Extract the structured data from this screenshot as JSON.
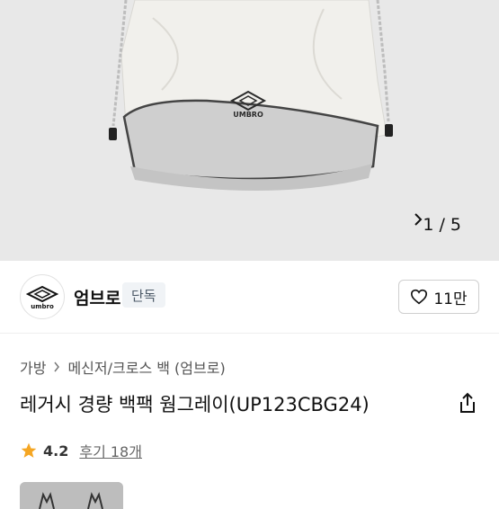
{
  "gallery": {
    "current": "1",
    "separator": "/",
    "total": "5",
    "next_icon": "chevron-right-icon",
    "background": "#e9e9e9"
  },
  "brand": {
    "logo_text": "umbro",
    "name": "엄브로",
    "badge": "단독",
    "like_count": "11만",
    "like_icon": "heart-outline-icon"
  },
  "breadcrumb": {
    "items": [
      "가방",
      "메신저/크로스 백 (엄브로)"
    ],
    "separator_icon": "chevron-right-icon"
  },
  "product": {
    "title": "레거시 경량 백팩 웜그레이(UP123CBG24)",
    "share_icon": "share-icon"
  },
  "rating": {
    "star_icon": "star-icon",
    "star_color": "#f5a623",
    "score": "4.2",
    "reviews": "후기 18개"
  },
  "bag_logo_text": "UMBRO"
}
